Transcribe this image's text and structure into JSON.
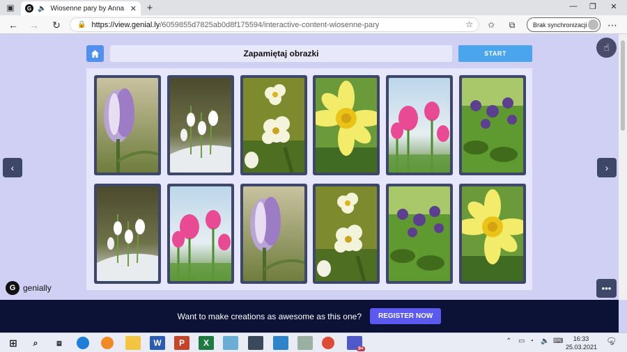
{
  "browser": {
    "tab_title": "Wiosenne pary by Anna Ma",
    "favicon_letter": "G",
    "url_host": "https://view.genial.ly",
    "url_path": "/6059855d7825ab0d8f175594/interactive-content-wiosenne-pary",
    "sync_label": "Brak synchronizacji"
  },
  "game": {
    "title": "Zapamiętaj obrazki",
    "start_label": "START"
  },
  "cards": [
    {
      "flower": "crocus"
    },
    {
      "flower": "snowdrop"
    },
    {
      "flower": "primrose"
    },
    {
      "flower": "daffodil"
    },
    {
      "flower": "tulip"
    },
    {
      "flower": "violet"
    },
    {
      "flower": "snowdrop"
    },
    {
      "flower": "tulip"
    },
    {
      "flower": "crocus"
    },
    {
      "flower": "primrose"
    },
    {
      "flower": "violet"
    },
    {
      "flower": "daffodil"
    }
  ],
  "brand": {
    "name": "genially"
  },
  "banner": {
    "text": "Want to make creations as awesome as this one?",
    "cta": "REGISTER NOW"
  },
  "taskbar": {
    "time": "16:33",
    "date": "25.03.2021",
    "teams_badge": "9+",
    "notif_count": "5"
  }
}
